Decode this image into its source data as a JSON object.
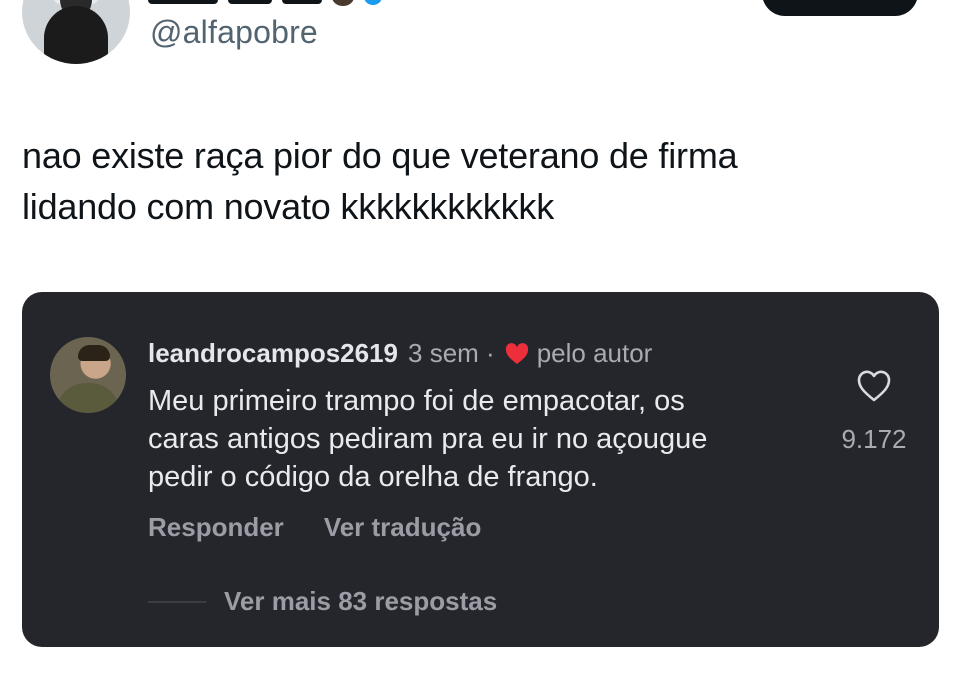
{
  "tweet": {
    "handle": "@alfapobre",
    "text_line1": "nao existe raça pior do que veterano de firma",
    "text_line2": "lidando com novato kkkkkkkkkkkk"
  },
  "comment": {
    "username": "leandrocampos2619",
    "time": "3 sem ·",
    "liked_by": "pelo autor",
    "body_line1": "Meu primeiro trampo foi de empacotar, os",
    "body_line2": "caras antigos pediram pra eu ir no açougue",
    "body_line3": "pedir o código da orelha de frango.",
    "like_count": "9.172",
    "reply_label": "Responder",
    "translate_label": "Ver tradução",
    "more_replies": "Ver mais 83 respostas"
  },
  "icons": {
    "liked_heart": "heart-filled-icon",
    "like_button": "heart-outline-icon"
  },
  "colors": {
    "card_bg": "#25262b",
    "heart_red": "#ed2f3c",
    "secondary_text": "#a8abb2"
  }
}
